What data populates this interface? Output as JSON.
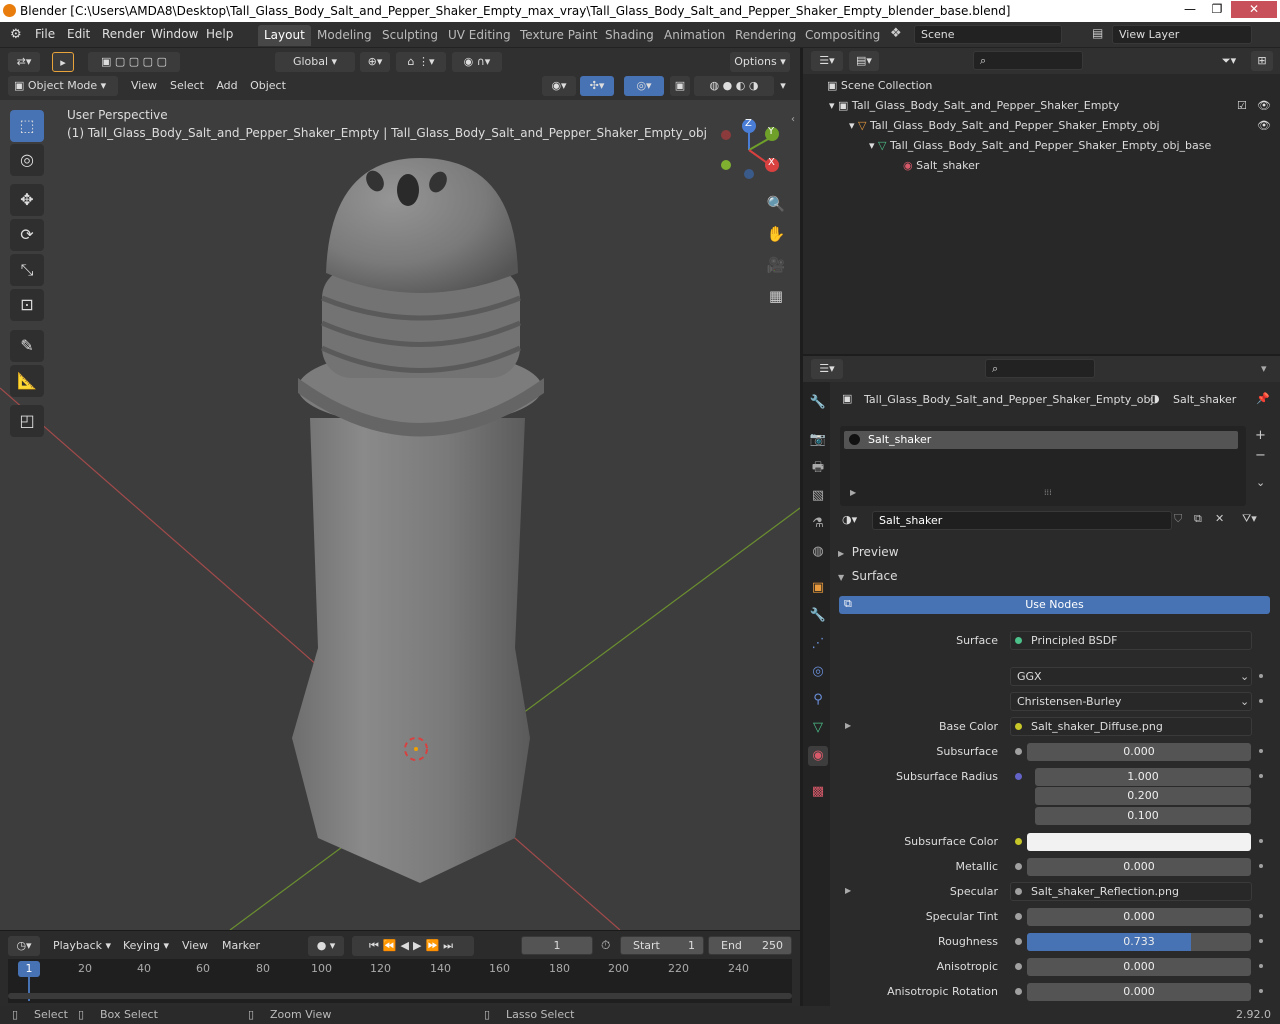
{
  "window": {
    "title": "Blender [C:\\Users\\AMDA8\\Desktop\\Tall_Glass_Body_Salt_and_Pepper_Shaker_Empty_max_vray\\Tall_Glass_Body_Salt_and_Pepper_Shaker_Empty_blender_base.blend]",
    "minimize": "—",
    "maximize": "❐",
    "close": "✕"
  },
  "menubar": {
    "items": [
      "File",
      "Edit",
      "Render",
      "Window",
      "Help"
    ]
  },
  "workspaces": [
    "Layout",
    "Modeling",
    "Sculpting",
    "UV Editing",
    "Texture Paint",
    "Shading",
    "Animation",
    "Rendering",
    "Compositing"
  ],
  "scene": {
    "scene_name": "Scene",
    "view_layer": "View Layer"
  },
  "viewport_header": {
    "transform_orientation": "Global",
    "options": "Options",
    "mode": "Object Mode",
    "menus": [
      "View",
      "Select",
      "Add",
      "Object"
    ]
  },
  "viewport": {
    "perspective_label": "User Perspective",
    "object_label": "(1) Tall_Glass_Body_Salt_and_Pepper_Shaker_Empty | Tall_Glass_Body_Salt_and_Pepper_Shaker_Empty_obj",
    "gizmo": {
      "x": "X",
      "y": "Y",
      "z": "Z"
    }
  },
  "outliner": {
    "root": "Scene Collection",
    "items": [
      {
        "label": "Tall_Glass_Body_Salt_and_Pepper_Shaker_Empty"
      },
      {
        "label": "Tall_Glass_Body_Salt_and_Pepper_Shaker_Empty_obj"
      },
      {
        "label": "Tall_Glass_Body_Salt_and_Pepper_Shaker_Empty_obj_base"
      },
      {
        "label": "Salt_shaker"
      }
    ]
  },
  "properties": {
    "object_name": "Tall_Glass_Body_Salt_and_Pepper_Shaker_Empty_obj",
    "material_name": "Salt_shaker",
    "slot": "Salt_shaker",
    "material_field": "Salt_shaker",
    "preview": "Preview",
    "surface_panel": "Surface",
    "use_nodes": "Use Nodes",
    "fields": {
      "surface_label": "Surface",
      "surface_value": "Principled BSDF",
      "distribution": "GGX",
      "subsurface_method": "Christensen-Burley",
      "base_color_label": "Base Color",
      "base_color_value": "Salt_shaker_Diffuse.png",
      "subsurface_label": "Subsurface",
      "subsurface_value": "0.000",
      "subsurface_radius_label": "Subsurface Radius",
      "radius_1": "1.000",
      "radius_2": "0.200",
      "radius_3": "0.100",
      "subsurface_color_label": "Subsurface Color",
      "metallic_label": "Metallic",
      "metallic_value": "0.000",
      "specular_label": "Specular",
      "specular_value": "Salt_shaker_Reflection.png",
      "specular_tint_label": "Specular Tint",
      "specular_tint_value": "0.000",
      "roughness_label": "Roughness",
      "roughness_value": "0.733",
      "roughness_fraction": 0.733,
      "anisotropic_label": "Anisotropic",
      "anisotropic_value": "0.000",
      "anisotropic_rotation_label": "Anisotropic Rotation",
      "anisotropic_rotation_value": "0.000"
    }
  },
  "timeline": {
    "menus": [
      "Playback",
      "Keying",
      "View",
      "Marker"
    ],
    "current_frame": "1",
    "start_label": "Start",
    "start_value": "1",
    "end_label": "End",
    "end_value": "250",
    "ruler": [
      "1",
      "20",
      "40",
      "60",
      "80",
      "100",
      "120",
      "140",
      "160",
      "180",
      "200",
      "220",
      "240"
    ]
  },
  "statusbar": {
    "select": "Select",
    "box_select": "Box Select",
    "zoom_view": "Zoom View",
    "lasso_select": "Lasso Select",
    "version": "2.92.0"
  },
  "colors": {
    "accent": "#4772b3",
    "header": "#303030",
    "viewport_bg": "#3d3d3d"
  }
}
